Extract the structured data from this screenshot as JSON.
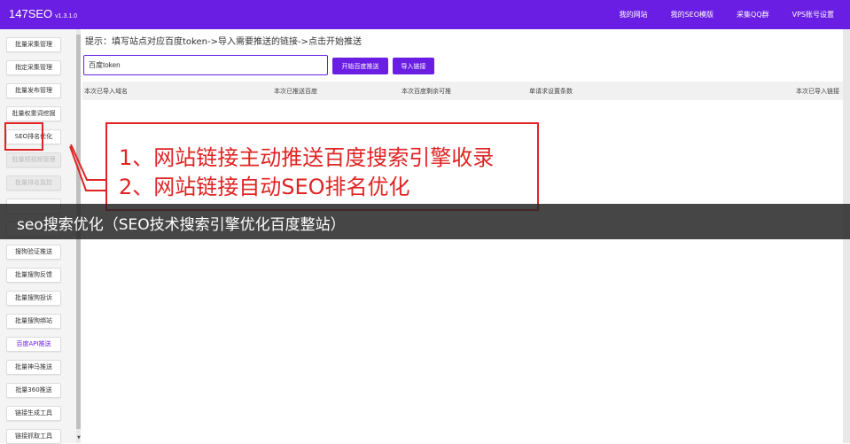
{
  "header": {
    "brand": "147SEO",
    "version": "v1.3.1.0",
    "nav": [
      "我的网站",
      "我的SEO模版",
      "采集QQ群",
      "VPS账号设置"
    ]
  },
  "sidebar": {
    "items": [
      {
        "label": "批量采集管理",
        "state": "normal"
      },
      {
        "label": "指定采集管理",
        "state": "normal"
      },
      {
        "label": "批量发布管理",
        "state": "normal"
      },
      {
        "label": "批量权重词挖掘",
        "state": "normal"
      },
      {
        "label": "SEO排名优化",
        "state": "normal"
      },
      {
        "label": "批量短视频管理",
        "state": "disabled"
      },
      {
        "label": "批量排名监控",
        "state": "disabled"
      },
      {
        "label": "",
        "state": "normal"
      },
      {
        "label": "",
        "state": "normal"
      },
      {
        "label": "搜狗验证推送",
        "state": "normal"
      },
      {
        "label": "批量搜狗反馈",
        "state": "normal"
      },
      {
        "label": "批量搜狗投诉",
        "state": "normal"
      },
      {
        "label": "批量搜狗绑站",
        "state": "normal"
      },
      {
        "label": "百度API推送",
        "state": "accent"
      },
      {
        "label": "批量神马推送",
        "state": "normal"
      },
      {
        "label": "批量360推送",
        "state": "normal"
      },
      {
        "label": "链接生成工具",
        "state": "normal"
      },
      {
        "label": "链接抓取工具",
        "state": "normal"
      }
    ]
  },
  "main": {
    "tip": "提示：填写站点对应百度token->导入需要推送的链接->点击开始推送",
    "token_value": "百度token",
    "token_placeholder": "百度token",
    "start_button": "开始百度推送",
    "import_button": "导入链接",
    "columns": [
      "本次已导入域名",
      "本次已推送百度",
      "本次百度剩余可推",
      "单请求设置条数",
      "本次已导入链接"
    ]
  },
  "callout": {
    "line1": "1、网站链接主动推送百度搜索引擎收录",
    "line2": "2、网站链接自动SEO排名优化"
  },
  "overlay": {
    "caption": "seo搜索优化（SEO技术搜索引擎优化百度整站）"
  },
  "colors": {
    "brand": "#6a1ee3",
    "callout": "#e02424"
  }
}
